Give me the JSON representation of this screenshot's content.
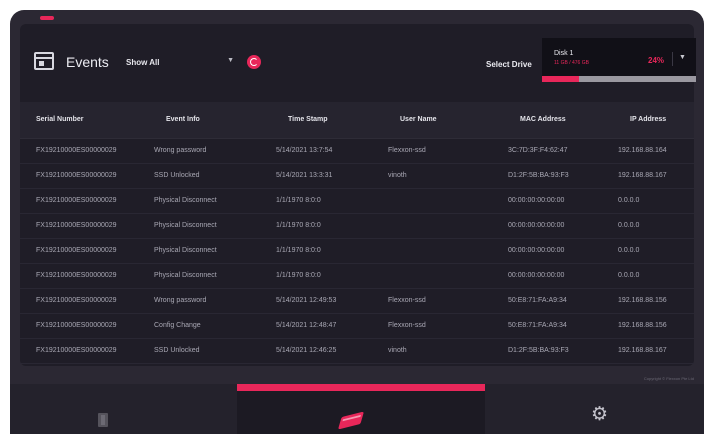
{
  "header": {
    "title": "Events",
    "filter_value": "Show All",
    "select_drive_label": "Select Drive"
  },
  "drive": {
    "name": "Disk 1",
    "size": "11 GB / 476 GB",
    "percent_label": "24%",
    "usage_fraction": 0.24
  },
  "icons": {
    "events": "events-icon",
    "refresh": "refresh-icon",
    "chevron": "chevron-down-icon",
    "drive_tab": "drive-icon",
    "events_tab": "events-book-icon",
    "settings_tab": "gear-icon"
  },
  "colors": {
    "accent": "#e8275a",
    "background": "#2b2833",
    "panel": "#1f1d27"
  },
  "table": {
    "columns": [
      "Serial Number",
      "Event Info",
      "Time Stamp",
      "User Name",
      "MAC Address",
      "IP Address"
    ],
    "rows": [
      [
        "FX19210000ES00000029",
        "Wrong password",
        "5/14/2021 13:7:54",
        "Flexxon-ssd",
        "3C:7D:3F:F4:62:47",
        "192.168.88.164"
      ],
      [
        "FX19210000ES00000029",
        "SSD Unlocked",
        "5/14/2021 13:3:31",
        "vinoth",
        "D1:2F:5B:BA:93:F3",
        "192.168.88.167"
      ],
      [
        "FX19210000ES00000029",
        "Physical Disconnect",
        "1/1/1970 8:0:0",
        "",
        "00:00:00:00:00:00",
        "0.0.0.0"
      ],
      [
        "FX19210000ES00000029",
        "Physical Disconnect",
        "1/1/1970 8:0:0",
        "",
        "00:00:00:00:00:00",
        "0.0.0.0"
      ],
      [
        "FX19210000ES00000029",
        "Physical Disconnect",
        "1/1/1970 8:0:0",
        "",
        "00:00:00:00:00:00",
        "0.0.0.0"
      ],
      [
        "FX19210000ES00000029",
        "Physical Disconnect",
        "1/1/1970 8:0:0",
        "",
        "00:00:00:00:00:00",
        "0.0.0.0"
      ],
      [
        "FX19210000ES00000029",
        "Wrong password",
        "5/14/2021 12:49:53",
        "Flexxon-ssd",
        "50:E8:71:FA:A9:34",
        "192.168.88.156"
      ],
      [
        "FX19210000ES00000029",
        "Config Change",
        "5/14/2021 12:48:47",
        "Flexxon-ssd",
        "50:E8:71:FA:A9:34",
        "192.168.88.156"
      ],
      [
        "FX19210000ES00000029",
        "SSD Unlocked",
        "5/14/2021 12:46:25",
        "vinoth",
        "D1:2F:5B:BA:93:F3",
        "192.168.88.167"
      ]
    ]
  },
  "footer": {
    "copyright": "Copyright © Flexxon Pte Ltd"
  },
  "nav": {
    "active_tab": "events"
  }
}
